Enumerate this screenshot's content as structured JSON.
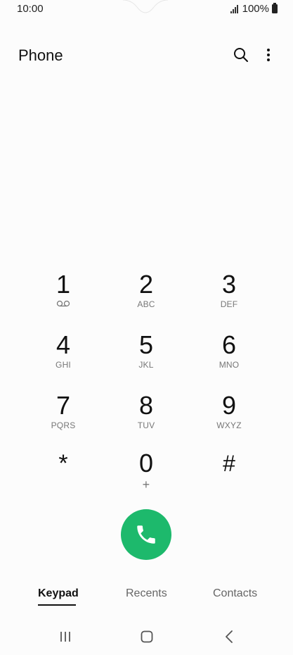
{
  "status_bar": {
    "time": "10:00",
    "battery_text": "100%",
    "icons": [
      "signal-icon",
      "battery-icon"
    ]
  },
  "header": {
    "title": "Phone",
    "icons": [
      "search-icon",
      "more-vert-icon"
    ]
  },
  "keypad": {
    "keys": [
      {
        "digit": "1",
        "letters": "",
        "icon": "voicemail-icon"
      },
      {
        "digit": "2",
        "letters": "ABC"
      },
      {
        "digit": "3",
        "letters": "DEF"
      },
      {
        "digit": "4",
        "letters": "GHI"
      },
      {
        "digit": "5",
        "letters": "JKL"
      },
      {
        "digit": "6",
        "letters": "MNO"
      },
      {
        "digit": "7",
        "letters": "PQRS"
      },
      {
        "digit": "8",
        "letters": "TUV"
      },
      {
        "digit": "9",
        "letters": "WXYZ"
      },
      {
        "digit": "*",
        "letters": ""
      },
      {
        "digit": "0",
        "letters": "+"
      },
      {
        "digit": "#",
        "letters": ""
      }
    ]
  },
  "call_button": {
    "icon": "phone-icon",
    "color": "#1db96c"
  },
  "tabs": [
    {
      "label": "Keypad",
      "active": true
    },
    {
      "label": "Recents",
      "active": false
    },
    {
      "label": "Contacts",
      "active": false
    }
  ],
  "navbar": {
    "icons": [
      "recent-apps-icon",
      "home-icon",
      "back-icon"
    ]
  }
}
